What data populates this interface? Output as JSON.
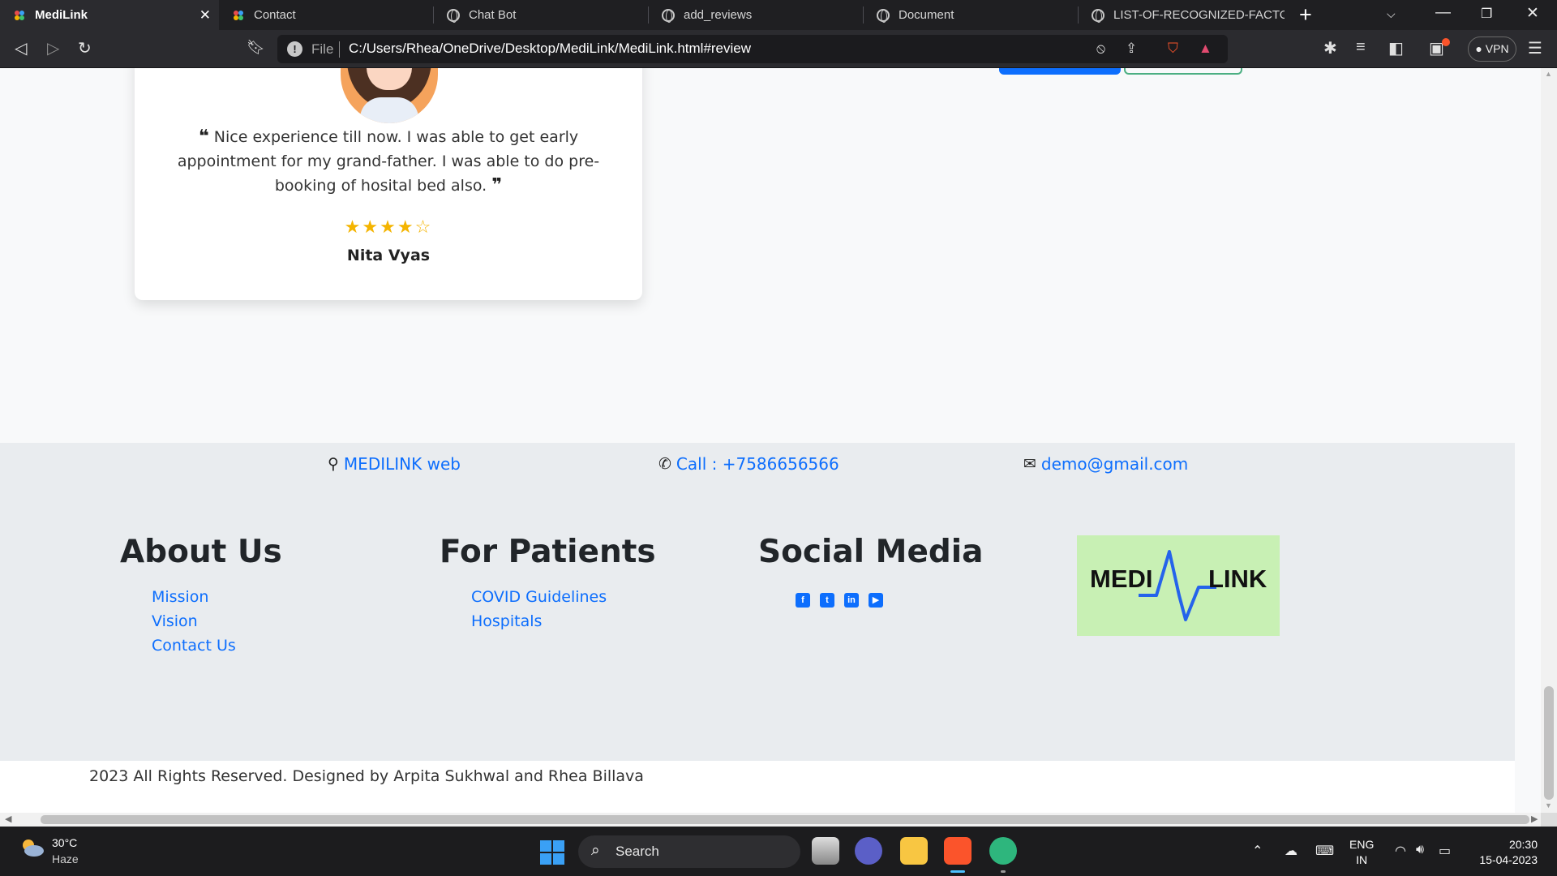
{
  "browser": {
    "tabs": [
      {
        "label": "MediLink",
        "active": true
      },
      {
        "label": "Contact"
      },
      {
        "label": "Chat Bot"
      },
      {
        "label": "add_reviews"
      },
      {
        "label": "Document"
      },
      {
        "label": "LIST-OF-RECOGNIZED-FACTORY"
      }
    ],
    "url_scheme_label": "File",
    "url": "C:/Users/Rhea/OneDrive/Desktop/MediLink/MediLink.html#review",
    "vpn_label": "VPN"
  },
  "review": {
    "text": "Nice experience till now. I was able to get early appointment for my grand-father. I was able to do pre-booking of hosital bed also.",
    "rating": 4,
    "rating_max": 5,
    "reviewer": "Nita Vyas"
  },
  "footer": {
    "contacts": [
      {
        "icon": "map-marker-icon",
        "label": "MEDILINK web"
      },
      {
        "icon": "phone-icon",
        "label": "Call : +7586656566"
      },
      {
        "icon": "envelope-icon",
        "label": "demo@gmail.com"
      }
    ],
    "about": {
      "title": "About Us",
      "links": [
        "Mission",
        "Vision",
        "Contact Us"
      ]
    },
    "patients": {
      "title": "For Patients",
      "links": [
        "COVID Guidelines",
        "Hospitals"
      ]
    },
    "social": {
      "title": "Social Media",
      "icons": [
        "facebook-icon",
        "twitter-icon",
        "linkedin-icon",
        "youtube-icon"
      ]
    },
    "logo": {
      "left": "MEDI",
      "right": "LINK"
    },
    "copyright": "2023 All Rights Reserved. Designed by Arpita Sukhwal and Rhea Billava"
  },
  "taskbar": {
    "weather_temp": "30°C",
    "weather_desc": "Haze",
    "search_label": "Search",
    "lang_top": "ENG",
    "lang_bottom": "IN",
    "time": "20:30",
    "date": "15-04-2023"
  },
  "colors": {
    "accent": "#0d6efd",
    "star": "#f4b400",
    "logo_bg": "#c8f0b4"
  }
}
